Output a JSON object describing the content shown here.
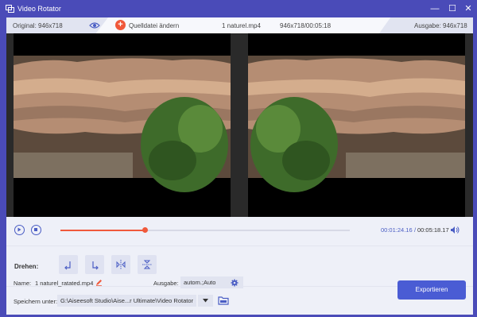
{
  "window": {
    "title": "Video Rotator",
    "minimize_glyph": "—",
    "maximize_glyph": "☐",
    "close_glyph": "✕"
  },
  "infobar": {
    "original": "Original: 946x718",
    "add_source": "Quelldatei ändern",
    "filename": "1 naturel.mp4",
    "resolution_duration": "946x718/00:05:18",
    "output": "Ausgabe: 946x718"
  },
  "playback": {
    "current_time": "00:01:24.16",
    "separator": "/",
    "total_time": "00:05:18.17",
    "progress_fraction": 0.29
  },
  "rotate": {
    "label": "Drehen:"
  },
  "output": {
    "name_label": "Name:",
    "name_value": "1 naturel_ratated.mp4",
    "format_label": "Ausgabe:",
    "format_value": "autom.;Auto",
    "save_label": "Speichern unter:",
    "save_path": "G:\\Aiseesoft Studio\\Aise...r Ultimate\\Video Rotator",
    "export_label": "Exportieren"
  },
  "colors": {
    "accent": "#4a5cd4",
    "progress": "#f0593b",
    "titlebar": "#4a4bb8"
  },
  "icons": [
    "window-icon",
    "eye-icon",
    "plus-icon",
    "play-icon",
    "stop-icon",
    "volume-icon",
    "rotate-left-icon",
    "rotate-right-icon",
    "flip-horizontal-icon",
    "flip-vertical-icon",
    "edit-icon",
    "gear-icon",
    "dropdown-icon",
    "folder-icon"
  ]
}
